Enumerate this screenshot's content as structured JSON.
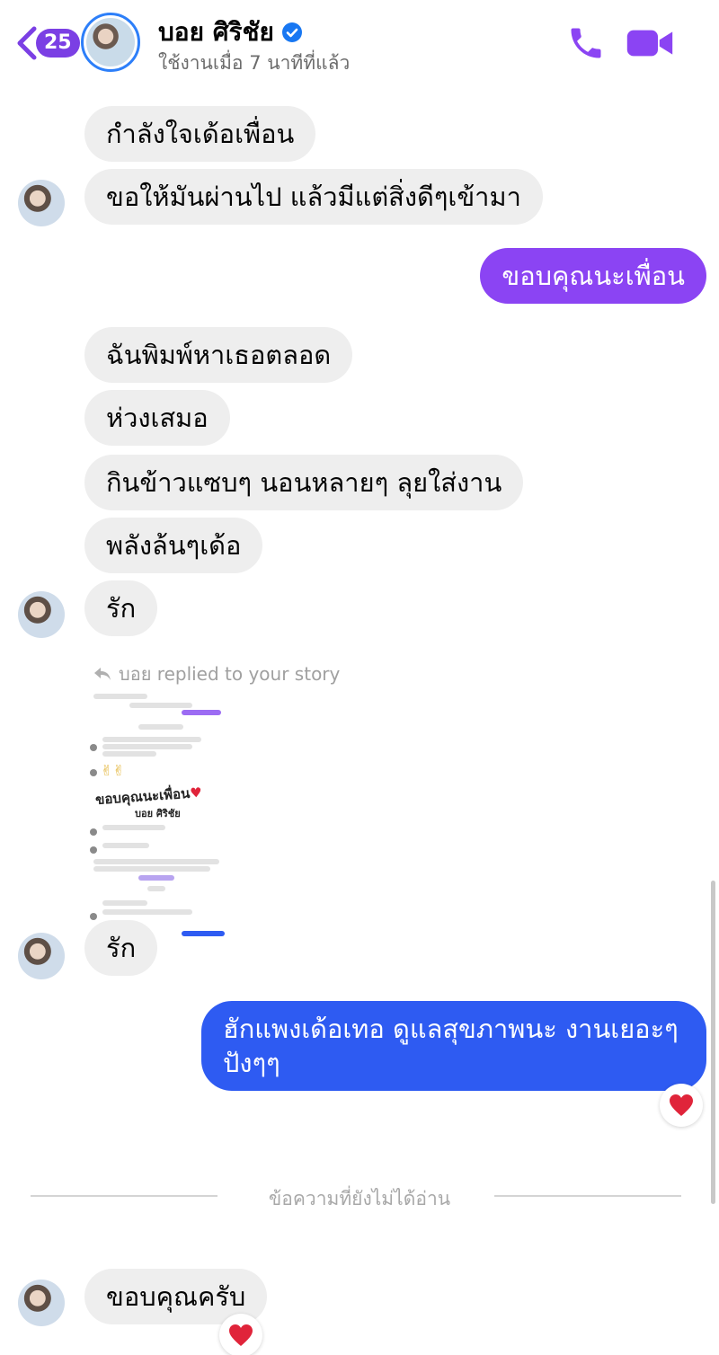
{
  "header": {
    "back_count": "25",
    "contact_name": "บอย ศิริชัย",
    "status": "ใช้งานเมื่อ 7 นาทีที่แล้ว",
    "accent_color": "#7b3fe4"
  },
  "messages": [
    {
      "side": "incoming",
      "text": "กำลังใจเด้อเพื่อน"
    },
    {
      "side": "incoming",
      "text": "ขอให้มันผ่านไป แล้วมีแต่สิ่งดีๆเข้ามา"
    },
    {
      "side": "outgoing",
      "text": "ขอบคุณนะเพื่อน"
    },
    {
      "side": "incoming",
      "text": "ฉันพิมพ์หาเธอตลอด"
    },
    {
      "side": "incoming",
      "text": "ห่วงเสมอ"
    },
    {
      "side": "incoming",
      "text": "กินข้าวแซบๆ นอนหลายๆ ลุยใส่งาน"
    },
    {
      "side": "incoming",
      "text": "พลังล้นๆเด้อ"
    },
    {
      "side": "incoming",
      "text": "รัก"
    },
    {
      "side": "incoming",
      "text": "รัก"
    },
    {
      "side": "outgoing",
      "text": "ฮักแพงเด้อเทอ ดูแลสุขภาพนะ งานเยอะๆ ปังๆๆ"
    },
    {
      "side": "incoming",
      "text": "ขอบคุณครับ"
    }
  ],
  "story_reply": {
    "label": "บอย replied to your story",
    "caption": "ขอบคุณนะเพื่อน",
    "caption_name": "บอย ศิริชัย"
  },
  "unread_divider": "ข้อความที่ยังไม่ได้อ่าน",
  "colors": {
    "incoming_bubble": "#eeeeee",
    "outgoing_purple": "#8b44f3",
    "outgoing_blue": "#2e5bf2",
    "reaction_heart": "#e0243a"
  },
  "icons": [
    "back-chevron-icon",
    "verified-badge-icon",
    "phone-icon",
    "video-camera-icon",
    "reply-arrow-icon",
    "heart-reaction-icon"
  ]
}
